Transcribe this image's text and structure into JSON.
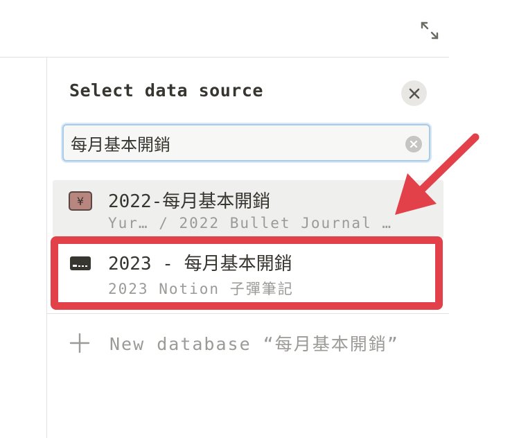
{
  "panel": {
    "title": "Select data source"
  },
  "search": {
    "value": "每月基本開銷",
    "placeholder": ""
  },
  "results": [
    {
      "title": "2022-每月基本開銷",
      "path": "Yur… / 2022 Bullet Journal …",
      "icon": "yen-icon",
      "hovered": true
    },
    {
      "title": "2023 - 每月基本開銷",
      "path": "2023 Notion 子彈筆記",
      "icon": "credit-card-icon",
      "highlighted": true
    }
  ],
  "new_database": {
    "label": "New database “每月基本開銷”",
    "icon": "plus-icon"
  },
  "icons": {
    "expand": "expand-icon",
    "close": "close-icon",
    "clear": "clear-search-icon"
  },
  "colors": {
    "annotation_red": "#e2414a",
    "search_focus": "#a9cbea",
    "text_primary": "#37352f",
    "text_secondary": "#9b9a97"
  }
}
